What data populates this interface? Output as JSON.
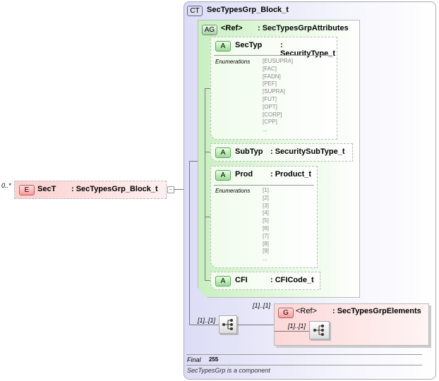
{
  "element": {
    "multiplicity": "0..*",
    "badge": "E",
    "name": "SecT",
    "type": ": SecTypesGrp_Block_t",
    "collapse": "−"
  },
  "complex_type": {
    "badge": "CT",
    "name": "SecTypesGrp_Block_t"
  },
  "attribute_group": {
    "badge": "AG",
    "name": "<Ref>",
    "type": ": SecTypesGrpAttributes"
  },
  "attributes": [
    {
      "badge": "A",
      "name": "SecTyp",
      "type": ": SecurityType_t",
      "enum_label": "Enumerations",
      "enums": [
        "[EUSUPRA]",
        "[FAC]",
        "[FADN]",
        "[PEF]",
        "[SUPRA]",
        "[FUT]",
        "[OPT]",
        "[CORP]",
        "[CPP]",
        "..."
      ]
    },
    {
      "badge": "A",
      "name": "SubTyp",
      "type": ": SecuritySubType_t"
    },
    {
      "badge": "A",
      "name": "Prod",
      "type": ": Product_t",
      "enum_label": "Enumerations",
      "enums": [
        "[1]",
        "[2]",
        "[3]",
        "[4]",
        "[5]",
        "[6]",
        "[7]",
        "[8]",
        "[9]",
        "..."
      ]
    },
    {
      "badge": "A",
      "name": "CFI",
      "type": ": CFICode_t"
    }
  ],
  "sequence": {
    "multiplicity": "[1]..[1]"
  },
  "group": {
    "multiplicity": "[1]..[1]",
    "badge": "G",
    "name": "<Ref>",
    "type": ": SecTypesGrpElements",
    "inner_multiplicity": "[1]..[1]"
  },
  "footer": {
    "final_label": "Final",
    "final_value": "255",
    "note": "SecTypesGrp is a component"
  },
  "colors": {
    "element_bg": "#fde0e0",
    "attr_green": "#c8f0c0",
    "ct_bg": "#dcdcf6",
    "group_bg": "#fde0e0"
  }
}
